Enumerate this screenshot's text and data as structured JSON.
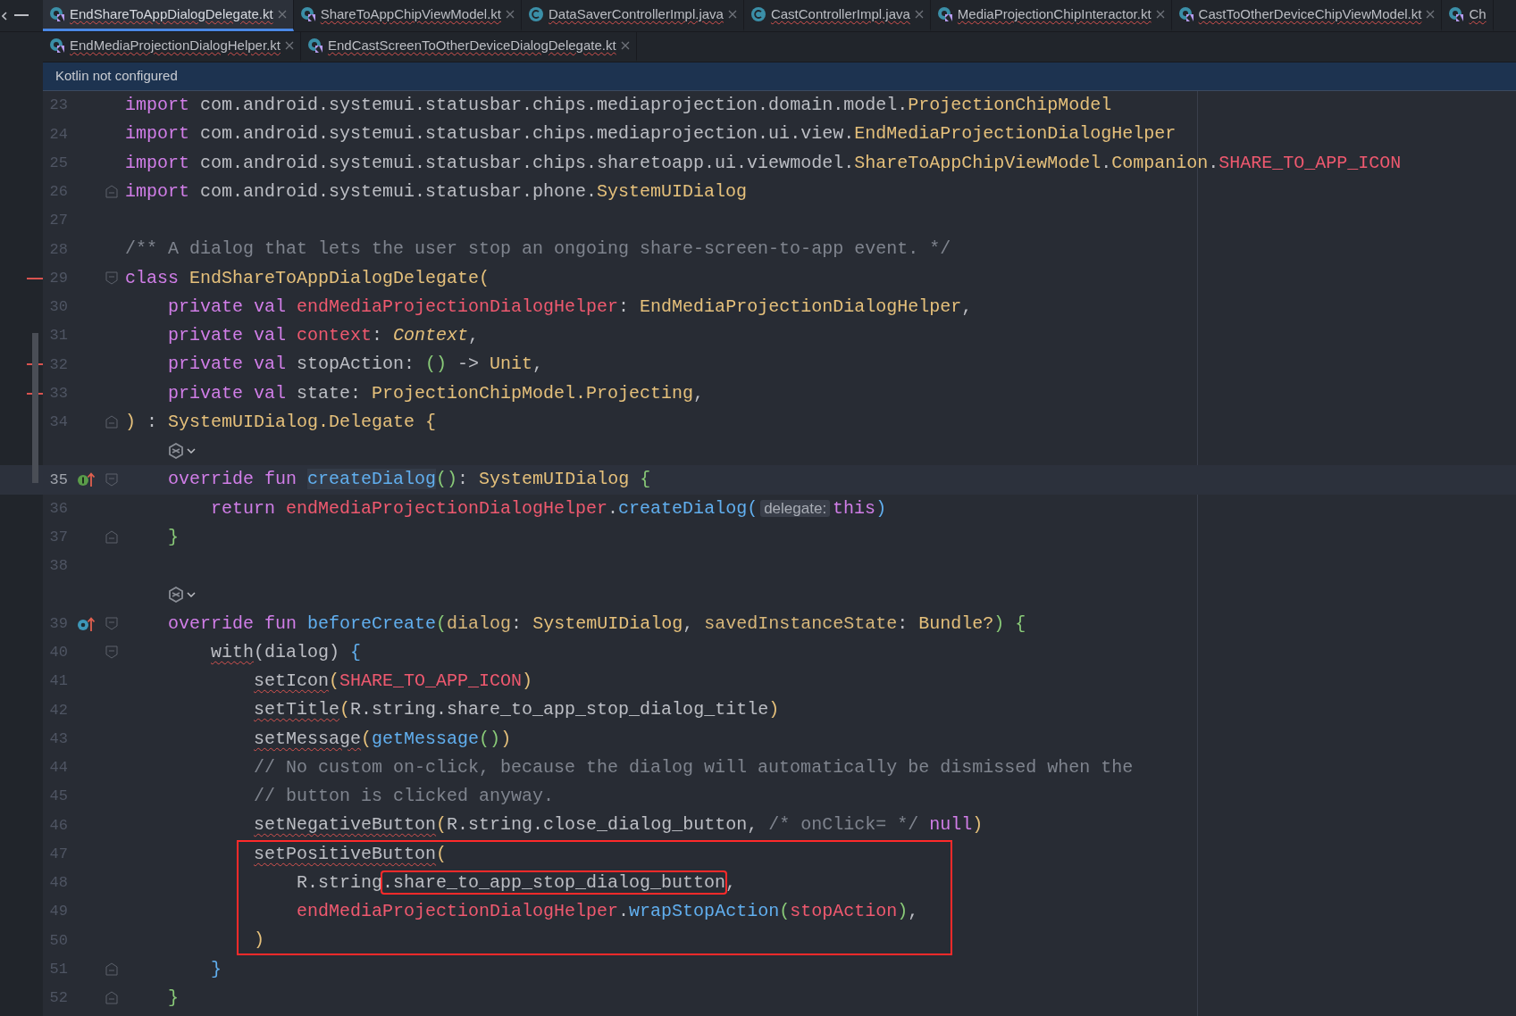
{
  "tab_rows": [
    [
      {
        "label": "EndShareToAppDialogDelegate.kt",
        "kind": "kotlin",
        "selected": true
      },
      {
        "label": "ShareToAppChipViewModel.kt",
        "kind": "kotlin",
        "selected": false
      },
      {
        "label": "DataSaverControllerImpl.java",
        "kind": "java",
        "selected": false
      },
      {
        "label": "CastControllerImpl.java",
        "kind": "java",
        "selected": false
      },
      {
        "label": "MediaProjectionChipInteractor.kt",
        "kind": "kotlin",
        "selected": false
      },
      {
        "label": "CastToOtherDeviceChipViewModel.kt",
        "kind": "kotlin",
        "selected": false
      },
      {
        "label": "Ch",
        "kind": "kotlin",
        "selected": false
      }
    ],
    [
      {
        "label": "EndMediaProjectionDialogHelper.kt",
        "kind": "kotlin",
        "selected": false
      },
      {
        "label": "EndCastScreenToOtherDeviceDialogDelegate.kt",
        "kind": "kotlin",
        "selected": false
      }
    ]
  ],
  "banner": "Kotlin not configured",
  "lines": [
    {
      "kind": "code",
      "number": "23",
      "tokens": [
        {
          "kind": "keyword",
          "text": "import"
        },
        {
          "kind": "plain",
          "text": " com.android.systemui.statusbar.chips.mediaprojection.domain.model."
        },
        {
          "kind": "type",
          "text": "ProjectionChipModel"
        }
      ]
    },
    {
      "kind": "code",
      "number": "24",
      "tokens": [
        {
          "kind": "keyword",
          "text": "import"
        },
        {
          "kind": "plain",
          "text": " com.android.systemui.statusbar.chips.mediaprojection.ui.view."
        },
        {
          "kind": "type",
          "text": "EndMediaProjectionDialogHelper"
        }
      ]
    },
    {
      "kind": "code",
      "number": "25",
      "tokens": [
        {
          "kind": "keyword",
          "text": "import"
        },
        {
          "kind": "plain",
          "text": " com.android.systemui.statusbar.chips.sharetoapp.ui.viewmodel."
        },
        {
          "kind": "type",
          "text": "ShareToAppChipViewModel"
        },
        {
          "kind": "plain",
          "text": "."
        },
        {
          "kind": "type",
          "text": "Companion"
        },
        {
          "kind": "plain",
          "text": "."
        },
        {
          "kind": "property",
          "text": "SHARE_TO_APP_ICON"
        }
      ]
    },
    {
      "kind": "code",
      "number": "26",
      "fold_marker": {
        "kind": "end"
      },
      "tokens": [
        {
          "kind": "keyword",
          "text": "import"
        },
        {
          "kind": "plain",
          "text": " com.android.systemui.statusbar.phone."
        },
        {
          "kind": "type",
          "text": "SystemUIDialog"
        }
      ]
    },
    {
      "kind": "code",
      "number": "27"
    },
    {
      "kind": "code",
      "number": "28",
      "tokens": [
        {
          "kind": "comment",
          "text": "/** A dialog that lets the user stop an ongoing share-screen-to-app event. */"
        }
      ]
    },
    {
      "kind": "code",
      "number": "29",
      "fold_marker": {
        "kind": "start"
      },
      "changed": true,
      "tokens": [
        {
          "kind": "keyword",
          "text": "class "
        },
        {
          "kind": "type",
          "text": "EndShareToAppDialogDelegate"
        },
        {
          "kind": "yellow",
          "text": "("
        }
      ]
    },
    {
      "kind": "code",
      "number": "30",
      "tokens": [
        {
          "kind": "keyword",
          "text": "    private val "
        },
        {
          "kind": "property",
          "text": "endMediaProjectionDialogHelper"
        },
        {
          "kind": "plain",
          "text": ": "
        },
        {
          "kind": "type",
          "text": "EndMediaProjectionDialogHelper"
        },
        {
          "kind": "plain",
          "text": ","
        }
      ]
    },
    {
      "kind": "code",
      "number": "31",
      "tokens": [
        {
          "kind": "keyword",
          "text": "    private val "
        },
        {
          "kind": "property",
          "text": "context"
        },
        {
          "kind": "plain",
          "text": ": "
        },
        {
          "kind": "italic",
          "text": "Context"
        },
        {
          "kind": "plain",
          "text": ","
        }
      ]
    },
    {
      "kind": "code",
      "number": "32",
      "changed": true,
      "tokens": [
        {
          "kind": "keyword",
          "text": "    private val "
        },
        {
          "kind": "plain",
          "text": "stopAction: "
        },
        {
          "kind": "green",
          "text": "()"
        },
        {
          "kind": "plain",
          "text": " -> "
        },
        {
          "kind": "type",
          "text": "Unit"
        },
        {
          "kind": "plain",
          "text": ","
        }
      ]
    },
    {
      "kind": "code",
      "number": "33",
      "changed": true,
      "tokens": [
        {
          "kind": "keyword",
          "text": "    private val "
        },
        {
          "kind": "plain",
          "text": "state: "
        },
        {
          "kind": "type",
          "text": "ProjectionChipModel.Projecting"
        },
        {
          "kind": "plain",
          "text": ","
        }
      ]
    },
    {
      "kind": "code",
      "number": "34",
      "fold_marker": {
        "kind": "end"
      },
      "tokens": [
        {
          "kind": "yellow",
          "text": ")"
        },
        {
          "kind": "plain",
          "text": " : "
        },
        {
          "kind": "type",
          "text": "SystemUIDialog.Delegate "
        },
        {
          "kind": "yellow",
          "text": "{"
        }
      ]
    },
    {
      "kind": "inlay"
    },
    {
      "kind": "code",
      "number": "35",
      "current": true,
      "gutter_icon": {
        "kind": "implements"
      },
      "fold_marker": {
        "kind": "start"
      },
      "tokens": [
        {
          "kind": "keyword",
          "text": "    override fun "
        },
        {
          "kind": "highlight",
          "text": "createDialog"
        },
        {
          "kind": "green",
          "text": "()"
        },
        {
          "kind": "plain",
          "text": ": "
        },
        {
          "kind": "type",
          "text": "SystemUIDialog "
        },
        {
          "kind": "green",
          "text": "{"
        }
      ]
    },
    {
      "kind": "code",
      "number": "36",
      "tokens": [
        {
          "kind": "keyword",
          "text": "        return "
        },
        {
          "kind": "property",
          "text": "endMediaProjectionDialogHelper"
        },
        {
          "kind": "plain",
          "text": "."
        },
        {
          "kind": "function",
          "text": "createDialog"
        },
        {
          "kind": "blue",
          "text": "("
        },
        {
          "kind": "hint",
          "text": "delegate:"
        },
        {
          "kind": "keyword",
          "text": "this"
        },
        {
          "kind": "blue",
          "text": ")"
        }
      ]
    },
    {
      "kind": "code",
      "number": "37",
      "fold_marker": {
        "kind": "end"
      },
      "tokens": [
        {
          "kind": "green",
          "text": "    }"
        }
      ]
    },
    {
      "kind": "code",
      "number": "38"
    },
    {
      "kind": "inlay"
    },
    {
      "kind": "code",
      "number": "39",
      "gutter_icon": {
        "kind": "overrides"
      },
      "fold_marker": {
        "kind": "start"
      },
      "tokens": [
        {
          "kind": "keyword",
          "text": "    override fun "
        },
        {
          "kind": "function",
          "text": "beforeCreate"
        },
        {
          "kind": "green",
          "text": "("
        },
        {
          "kind": "param",
          "text": "dialog"
        },
        {
          "kind": "plain",
          "text": ": "
        },
        {
          "kind": "type",
          "text": "SystemUIDialog"
        },
        {
          "kind": "plain",
          "text": ", "
        },
        {
          "kind": "param",
          "text": "savedInstanceState"
        },
        {
          "kind": "plain",
          "text": ": "
        },
        {
          "kind": "type",
          "text": "Bundle?"
        },
        {
          "kind": "green",
          "text": ") {"
        }
      ]
    },
    {
      "kind": "code",
      "number": "40",
      "fold_marker": {
        "kind": "start"
      },
      "tokens": [
        {
          "kind": "plain",
          "text": "        with",
          "squiggle": true
        },
        {
          "kind": "plain",
          "text": "(dialog) "
        },
        {
          "kind": "blue",
          "text": "{"
        }
      ]
    },
    {
      "kind": "code",
      "number": "41",
      "tokens": [
        {
          "kind": "plain",
          "text": "            setIcon",
          "squiggle": true
        },
        {
          "kind": "yellow",
          "text": "("
        },
        {
          "kind": "property",
          "text": "SHARE_TO_APP_ICON"
        },
        {
          "kind": "yellow",
          "text": ")"
        }
      ]
    },
    {
      "kind": "code",
      "number": "42",
      "tokens": [
        {
          "kind": "plain",
          "text": "            setTitle",
          "squiggle": true
        },
        {
          "kind": "yellow",
          "text": "("
        },
        {
          "kind": "plain",
          "text": "R.string.share_to_app_stop_dialog_title"
        },
        {
          "kind": "yellow",
          "text": ")"
        }
      ]
    },
    {
      "kind": "code",
      "number": "43",
      "tokens": [
        {
          "kind": "plain",
          "text": "            setMessage",
          "squiggle": true
        },
        {
          "kind": "yellow",
          "text": "("
        },
        {
          "kind": "function",
          "text": "getMessage"
        },
        {
          "kind": "green",
          "text": "()"
        },
        {
          "kind": "yellow",
          "text": ")"
        }
      ]
    },
    {
      "kind": "code",
      "number": "44",
      "tokens": [
        {
          "kind": "comment",
          "text": "            // No custom on-click, because the dialog will automatically be dismissed when the"
        }
      ]
    },
    {
      "kind": "code",
      "number": "45",
      "tokens": [
        {
          "kind": "comment",
          "text": "            // button is clicked anyway."
        }
      ]
    },
    {
      "kind": "code",
      "number": "46",
      "tokens": [
        {
          "kind": "plain",
          "text": "            setNegativeButton",
          "squiggle": true
        },
        {
          "kind": "yellow",
          "text": "("
        },
        {
          "kind": "plain",
          "text": "R.string.close_dialog_button, "
        },
        {
          "kind": "comment",
          "text": "/* onClick= */ "
        },
        {
          "kind": "keyword",
          "text": "null"
        },
        {
          "kind": "yellow",
          "text": ")"
        }
      ]
    },
    {
      "kind": "code",
      "number": "47",
      "in_box": true,
      "tokens": [
        {
          "kind": "plain",
          "text": "            setPositiveButton",
          "squiggle": true
        },
        {
          "kind": "yellow",
          "text": "("
        }
      ]
    },
    {
      "kind": "code",
      "number": "48",
      "in_box": true,
      "tokens": [
        {
          "kind": "plain",
          "text": "                R.string"
        },
        {
          "kind": "boxed",
          "text": ".share_to_app_stop_dialog_button"
        },
        {
          "kind": "plain",
          "text": ","
        }
      ]
    },
    {
      "kind": "code",
      "number": "49",
      "in_box": true,
      "tokens": [
        {
          "kind": "property",
          "text": "                endMediaProjectionDialogHelper"
        },
        {
          "kind": "plain",
          "text": "."
        },
        {
          "kind": "function",
          "text": "wrapStopAction"
        },
        {
          "kind": "green",
          "text": "("
        },
        {
          "kind": "property",
          "text": "stopAction"
        },
        {
          "kind": "green",
          "text": ")"
        },
        {
          "kind": "plain",
          "text": ","
        }
      ]
    },
    {
      "kind": "code",
      "number": "50",
      "in_box": true,
      "tokens": [
        {
          "kind": "yellow",
          "text": "            )"
        }
      ]
    },
    {
      "kind": "code",
      "number": "51",
      "fold_marker": {
        "kind": "end"
      },
      "tokens": [
        {
          "kind": "blue",
          "text": "        }"
        }
      ]
    },
    {
      "kind": "code",
      "number": "52",
      "fold_marker": {
        "kind": "end"
      },
      "tokens": [
        {
          "kind": "green",
          "text": "    }"
        }
      ]
    }
  ]
}
